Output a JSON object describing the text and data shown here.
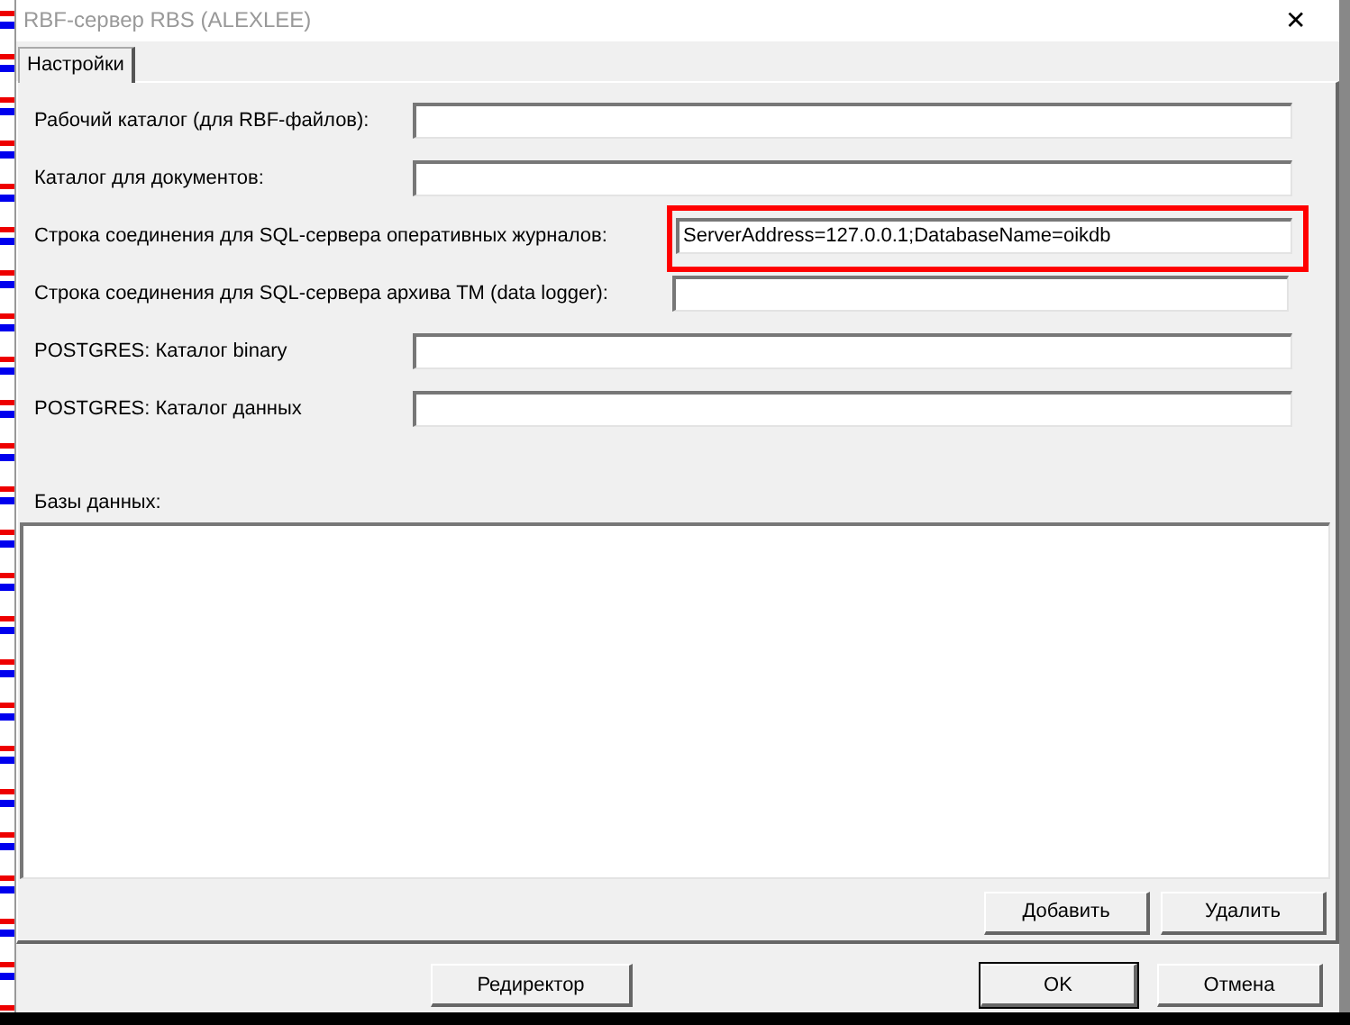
{
  "window": {
    "title": "RBF-сервер RBS (ALEXLEE)",
    "close": "✕"
  },
  "tabs": [
    {
      "label": "Настройки",
      "selected": true
    }
  ],
  "fields": [
    {
      "kind": "wide",
      "label": "Рабочий каталог (для RBF-файлов):",
      "highlighted": false
    },
    {
      "kind": "wide",
      "label": "Каталог для документов:",
      "highlighted": false
    },
    {
      "kind": "narrow",
      "label": "Строка соединения для SQL-сервера оперативных журналов:",
      "value": "ServerAddress=127.0.0.1;DatabaseName=oikdb",
      "highlighted": true
    },
    {
      "kind": "narrow",
      "label": "Строка соединения для SQL-сервера архива ТМ (data logger):",
      "highlighted": false
    },
    {
      "kind": "wide",
      "label": "POSTGRES: Каталог binary",
      "highlighted": false
    },
    {
      "kind": "wide",
      "label": "POSTGRES: Каталог данных",
      "highlighted": false
    }
  ],
  "databases": {
    "label": "Базы данных:",
    "buttons": [
      "Добавить",
      "Удалить"
    ]
  },
  "footer": {
    "left_button": "Редиректор",
    "buttons": [
      "OK",
      "Отмена"
    ]
  }
}
